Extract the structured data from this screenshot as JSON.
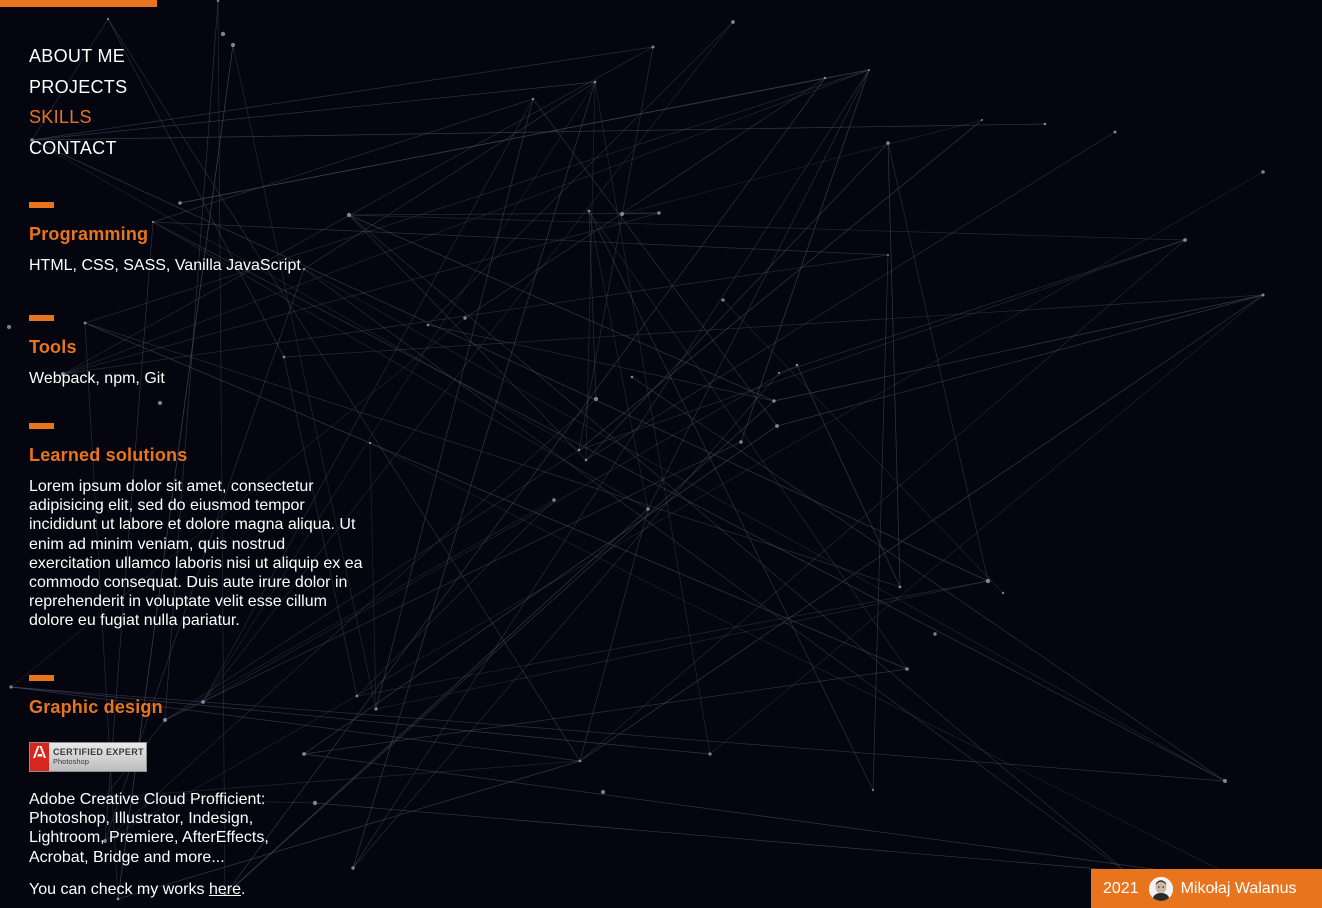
{
  "nav": {
    "items": [
      {
        "label": "ABOUT ME",
        "active": false
      },
      {
        "label": "PROJECTS",
        "active": false
      },
      {
        "label": "SKILLS",
        "active": true
      },
      {
        "label": "CONTACT",
        "active": false
      }
    ]
  },
  "sections": {
    "programming": {
      "title": "Programming",
      "text": "HTML, CSS, SASS, Vanilla JavaScript"
    },
    "tools": {
      "title": "Tools",
      "text": "Webpack, npm, Git"
    },
    "learned": {
      "title": "Learned solutions",
      "text": "Lorem ipsum dolor sit amet, consectetur adipisicing elit, sed do eiusmod tempor incididunt ut labore et dolore magna aliqua. Ut enim ad minim veniam, quis nostrud exercitation ullamco laboris nisi ut aliquip ex ea commodo consequat. Duis aute irure dolor in reprehenderit in voluptate velit esse cillum dolore eu fugiat nulla pariatur."
    },
    "graphic": {
      "title": "Graphic design",
      "badge_logo": "Adobe",
      "badge_line1": "CERTIFIED EXPERT",
      "badge_line2": "Photoshop",
      "text": "Adobe Creative Cloud Profficient: Photoshop, Illustrator, Indesign, Lightroom, Premiere, AfterEffects, Acrobat, Bridge and more...",
      "works_prefix": "You can check my works ",
      "works_link": "here",
      "works_suffix": "."
    }
  },
  "footer": {
    "year": "2021",
    "author": "Mikołaj Walanus"
  },
  "colors": {
    "accent": "#e8741e",
    "background": "#05050f",
    "text": "#ffffff",
    "network_lines": "#4a4f63"
  },
  "icons": {
    "badge": "adobe-logo-icon",
    "avatar": "author-avatar-icon"
  }
}
